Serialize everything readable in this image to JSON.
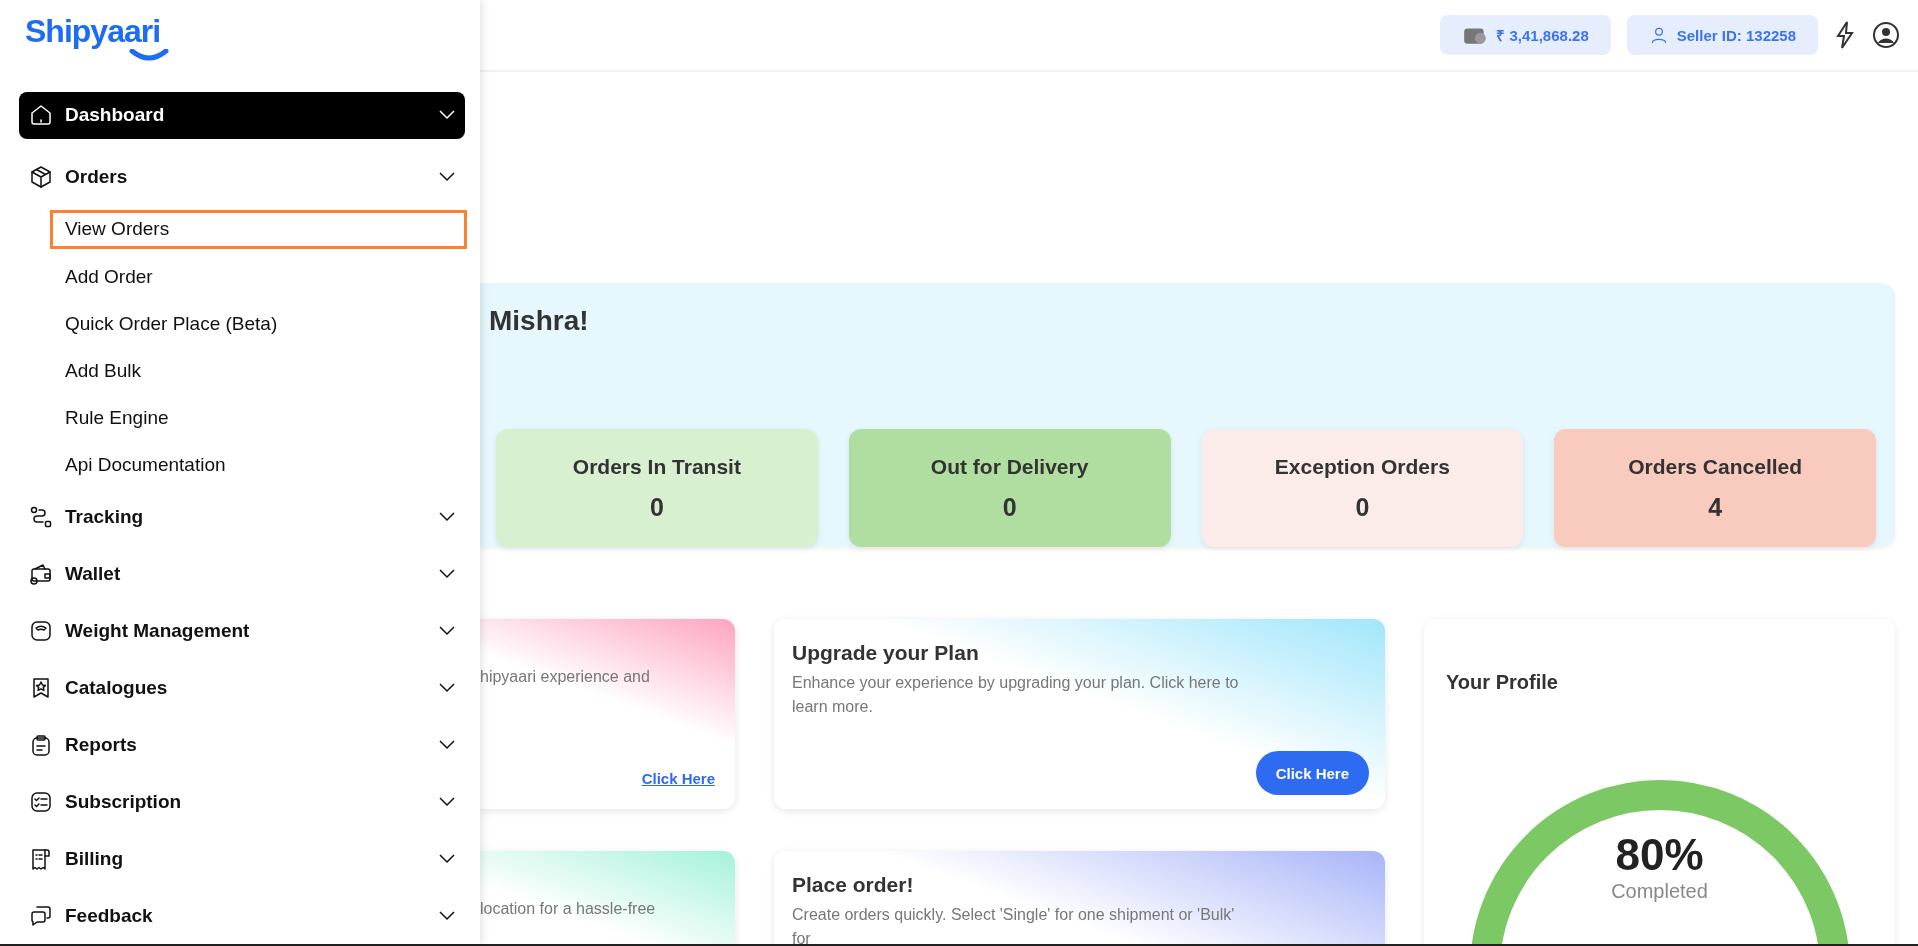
{
  "logo": "Shipyaari",
  "header": {
    "balance": "₹ 3,41,868.28",
    "seller_id": "Seller ID: 132258"
  },
  "sidebar": {
    "items": [
      {
        "label": "Dashboard",
        "selected": true,
        "expanded": false
      },
      {
        "label": "Orders",
        "selected": false,
        "expanded": true,
        "children": [
          {
            "label": "View Orders",
            "selected": true
          },
          {
            "label": "Add Order",
            "selected": false
          },
          {
            "label": "Quick Order Place (Beta)",
            "selected": false
          },
          {
            "label": "Add Bulk",
            "selected": false
          },
          {
            "label": "Rule Engine",
            "selected": false
          },
          {
            "label": "Api Documentation",
            "selected": false
          }
        ]
      },
      {
        "label": "Tracking",
        "selected": false,
        "expanded": false
      },
      {
        "label": "Wallet",
        "selected": false,
        "expanded": false
      },
      {
        "label": "Weight Management",
        "selected": false,
        "expanded": false
      },
      {
        "label": "Catalogues",
        "selected": false,
        "expanded": false
      },
      {
        "label": "Reports",
        "selected": false,
        "expanded": false
      },
      {
        "label": "Subscription",
        "selected": false,
        "expanded": false
      },
      {
        "label": "Billing",
        "selected": false,
        "expanded": false
      },
      {
        "label": "Feedback",
        "selected": false,
        "expanded": false
      }
    ]
  },
  "welcome": "Mishra!",
  "stats": [
    {
      "label": "Orders In Transit",
      "value": "0",
      "color": "#d8efd0"
    },
    {
      "label": "Out for Delivery",
      "value": "0",
      "color": "#b0dea0"
    },
    {
      "label": "Exception Orders",
      "value": "0",
      "color": "#fcece9"
    },
    {
      "label": "Orders Cancelled",
      "value": "4",
      "color": "#f9cabe"
    }
  ],
  "cards": [
    {
      "kind": "link",
      "text": "hipyaari experience and",
      "action": "Click Here",
      "color": "#fda4c0"
    },
    {
      "kind": "button",
      "title": "Upgrade your Plan",
      "text": "Enhance your experience by upgrading your plan. Click here to learn more.",
      "action": "Click Here",
      "color": "#a0e6fb"
    },
    {
      "text": "location for a hassle-free",
      "color": "#a4f2da"
    },
    {
      "title": "Place order!",
      "text": "Create orders quickly. Select 'Single' for one shipment or 'Bulk' for",
      "color": "#a8b4f8"
    }
  ],
  "profile": {
    "title": "Your Profile",
    "percent": "80%",
    "caption": "Completed"
  }
}
